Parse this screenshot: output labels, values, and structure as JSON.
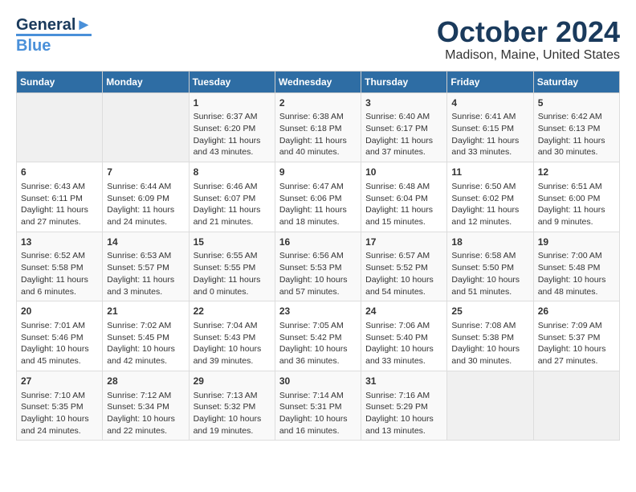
{
  "logo": {
    "line1": "General",
    "line2": "Blue"
  },
  "title": "October 2024",
  "subtitle": "Madison, Maine, United States",
  "days_of_week": [
    "Sunday",
    "Monday",
    "Tuesday",
    "Wednesday",
    "Thursday",
    "Friday",
    "Saturday"
  ],
  "weeks": [
    [
      {
        "day": "",
        "data": ""
      },
      {
        "day": "",
        "data": ""
      },
      {
        "day": "1",
        "sunrise": "Sunrise: 6:37 AM",
        "sunset": "Sunset: 6:20 PM",
        "daylight": "Daylight: 11 hours and 43 minutes."
      },
      {
        "day": "2",
        "sunrise": "Sunrise: 6:38 AM",
        "sunset": "Sunset: 6:18 PM",
        "daylight": "Daylight: 11 hours and 40 minutes."
      },
      {
        "day": "3",
        "sunrise": "Sunrise: 6:40 AM",
        "sunset": "Sunset: 6:17 PM",
        "daylight": "Daylight: 11 hours and 37 minutes."
      },
      {
        "day": "4",
        "sunrise": "Sunrise: 6:41 AM",
        "sunset": "Sunset: 6:15 PM",
        "daylight": "Daylight: 11 hours and 33 minutes."
      },
      {
        "day": "5",
        "sunrise": "Sunrise: 6:42 AM",
        "sunset": "Sunset: 6:13 PM",
        "daylight": "Daylight: 11 hours and 30 minutes."
      }
    ],
    [
      {
        "day": "6",
        "sunrise": "Sunrise: 6:43 AM",
        "sunset": "Sunset: 6:11 PM",
        "daylight": "Daylight: 11 hours and 27 minutes."
      },
      {
        "day": "7",
        "sunrise": "Sunrise: 6:44 AM",
        "sunset": "Sunset: 6:09 PM",
        "daylight": "Daylight: 11 hours and 24 minutes."
      },
      {
        "day": "8",
        "sunrise": "Sunrise: 6:46 AM",
        "sunset": "Sunset: 6:07 PM",
        "daylight": "Daylight: 11 hours and 21 minutes."
      },
      {
        "day": "9",
        "sunrise": "Sunrise: 6:47 AM",
        "sunset": "Sunset: 6:06 PM",
        "daylight": "Daylight: 11 hours and 18 minutes."
      },
      {
        "day": "10",
        "sunrise": "Sunrise: 6:48 AM",
        "sunset": "Sunset: 6:04 PM",
        "daylight": "Daylight: 11 hours and 15 minutes."
      },
      {
        "day": "11",
        "sunrise": "Sunrise: 6:50 AM",
        "sunset": "Sunset: 6:02 PM",
        "daylight": "Daylight: 11 hours and 12 minutes."
      },
      {
        "day": "12",
        "sunrise": "Sunrise: 6:51 AM",
        "sunset": "Sunset: 6:00 PM",
        "daylight": "Daylight: 11 hours and 9 minutes."
      }
    ],
    [
      {
        "day": "13",
        "sunrise": "Sunrise: 6:52 AM",
        "sunset": "Sunset: 5:58 PM",
        "daylight": "Daylight: 11 hours and 6 minutes."
      },
      {
        "day": "14",
        "sunrise": "Sunrise: 6:53 AM",
        "sunset": "Sunset: 5:57 PM",
        "daylight": "Daylight: 11 hours and 3 minutes."
      },
      {
        "day": "15",
        "sunrise": "Sunrise: 6:55 AM",
        "sunset": "Sunset: 5:55 PM",
        "daylight": "Daylight: 11 hours and 0 minutes."
      },
      {
        "day": "16",
        "sunrise": "Sunrise: 6:56 AM",
        "sunset": "Sunset: 5:53 PM",
        "daylight": "Daylight: 10 hours and 57 minutes."
      },
      {
        "day": "17",
        "sunrise": "Sunrise: 6:57 AM",
        "sunset": "Sunset: 5:52 PM",
        "daylight": "Daylight: 10 hours and 54 minutes."
      },
      {
        "day": "18",
        "sunrise": "Sunrise: 6:58 AM",
        "sunset": "Sunset: 5:50 PM",
        "daylight": "Daylight: 10 hours and 51 minutes."
      },
      {
        "day": "19",
        "sunrise": "Sunrise: 7:00 AM",
        "sunset": "Sunset: 5:48 PM",
        "daylight": "Daylight: 10 hours and 48 minutes."
      }
    ],
    [
      {
        "day": "20",
        "sunrise": "Sunrise: 7:01 AM",
        "sunset": "Sunset: 5:46 PM",
        "daylight": "Daylight: 10 hours and 45 minutes."
      },
      {
        "day": "21",
        "sunrise": "Sunrise: 7:02 AM",
        "sunset": "Sunset: 5:45 PM",
        "daylight": "Daylight: 10 hours and 42 minutes."
      },
      {
        "day": "22",
        "sunrise": "Sunrise: 7:04 AM",
        "sunset": "Sunset: 5:43 PM",
        "daylight": "Daylight: 10 hours and 39 minutes."
      },
      {
        "day": "23",
        "sunrise": "Sunrise: 7:05 AM",
        "sunset": "Sunset: 5:42 PM",
        "daylight": "Daylight: 10 hours and 36 minutes."
      },
      {
        "day": "24",
        "sunrise": "Sunrise: 7:06 AM",
        "sunset": "Sunset: 5:40 PM",
        "daylight": "Daylight: 10 hours and 33 minutes."
      },
      {
        "day": "25",
        "sunrise": "Sunrise: 7:08 AM",
        "sunset": "Sunset: 5:38 PM",
        "daylight": "Daylight: 10 hours and 30 minutes."
      },
      {
        "day": "26",
        "sunrise": "Sunrise: 7:09 AM",
        "sunset": "Sunset: 5:37 PM",
        "daylight": "Daylight: 10 hours and 27 minutes."
      }
    ],
    [
      {
        "day": "27",
        "sunrise": "Sunrise: 7:10 AM",
        "sunset": "Sunset: 5:35 PM",
        "daylight": "Daylight: 10 hours and 24 minutes."
      },
      {
        "day": "28",
        "sunrise": "Sunrise: 7:12 AM",
        "sunset": "Sunset: 5:34 PM",
        "daylight": "Daylight: 10 hours and 22 minutes."
      },
      {
        "day": "29",
        "sunrise": "Sunrise: 7:13 AM",
        "sunset": "Sunset: 5:32 PM",
        "daylight": "Daylight: 10 hours and 19 minutes."
      },
      {
        "day": "30",
        "sunrise": "Sunrise: 7:14 AM",
        "sunset": "Sunset: 5:31 PM",
        "daylight": "Daylight: 10 hours and 16 minutes."
      },
      {
        "day": "31",
        "sunrise": "Sunrise: 7:16 AM",
        "sunset": "Sunset: 5:29 PM",
        "daylight": "Daylight: 10 hours and 13 minutes."
      },
      {
        "day": "",
        "data": ""
      },
      {
        "day": "",
        "data": ""
      }
    ]
  ]
}
